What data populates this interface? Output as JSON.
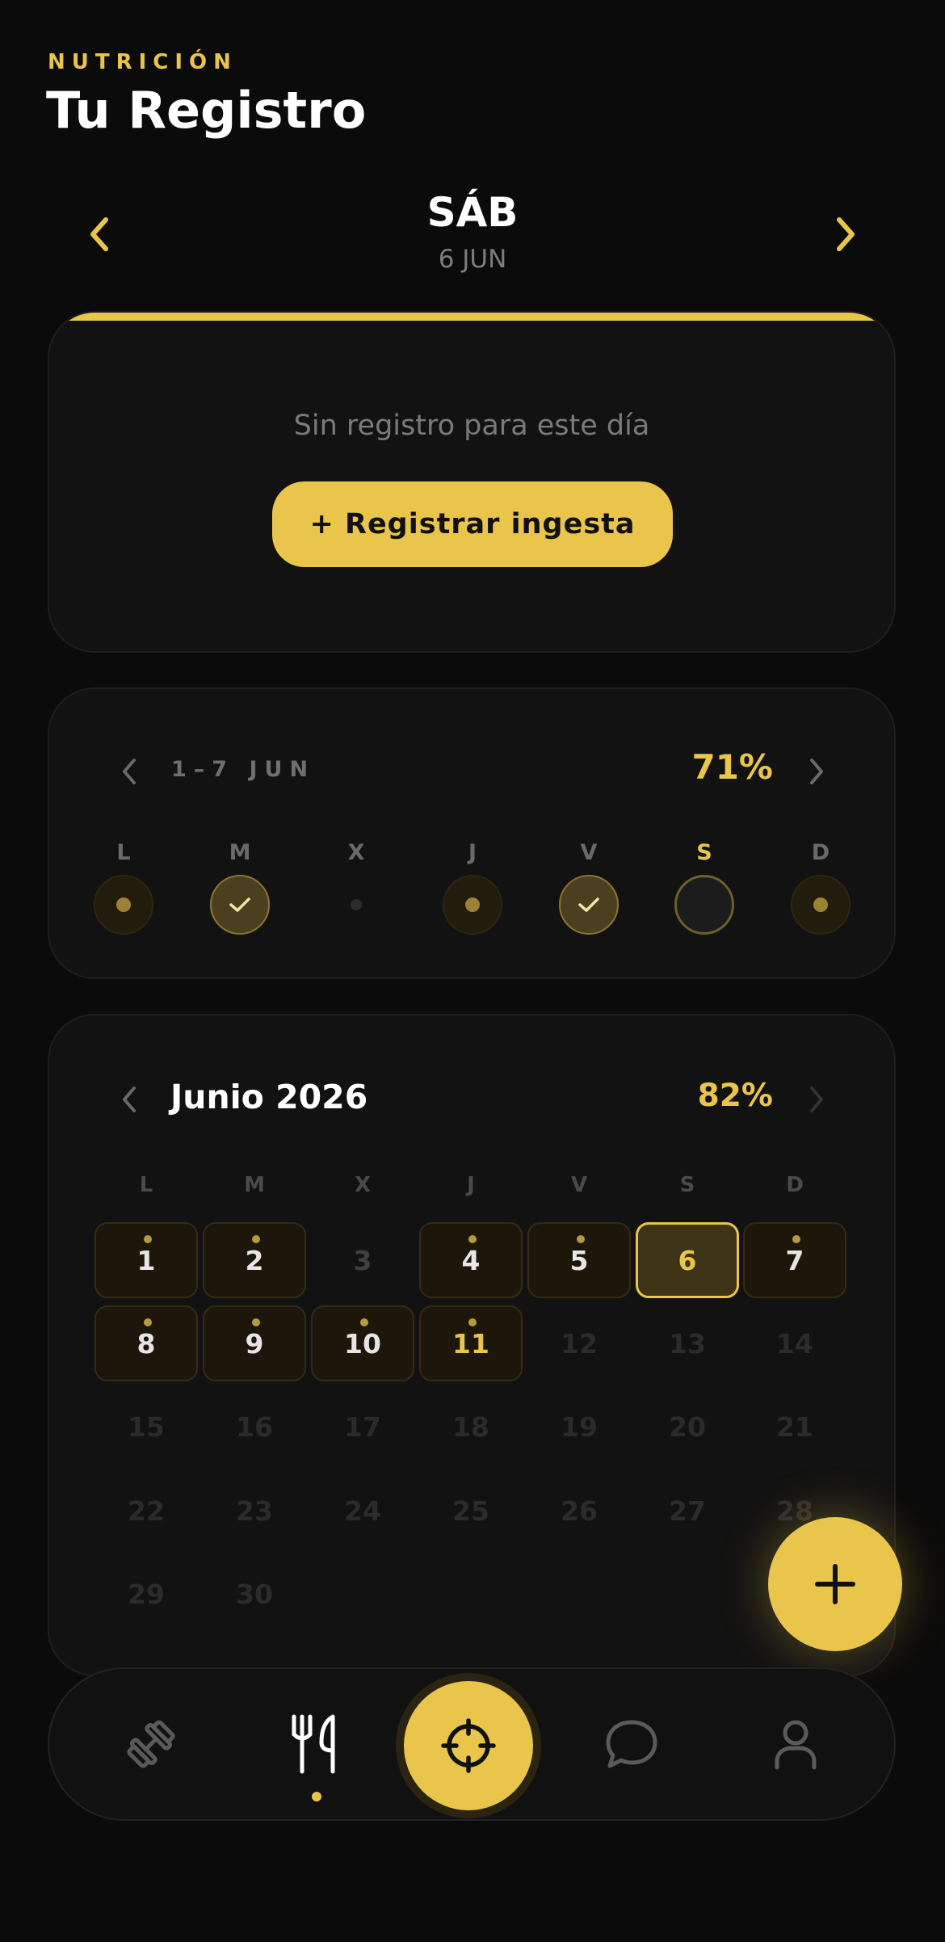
{
  "header": {
    "overline": "NUTRICIÓN",
    "title": "Tu Registro"
  },
  "day_nav": {
    "day_name": "SÁB",
    "date": "6 JUN"
  },
  "empty_day": {
    "message": "Sin registro para este día",
    "button_label": "+ Registrar ingesta"
  },
  "week": {
    "range": "1–7 JUN",
    "percent": "71%",
    "days": [
      {
        "label": "L",
        "state": "logged"
      },
      {
        "label": "M",
        "state": "complete"
      },
      {
        "label": "X",
        "state": "empty"
      },
      {
        "label": "J",
        "state": "logged"
      },
      {
        "label": "V",
        "state": "complete"
      },
      {
        "label": "S",
        "state": "today"
      },
      {
        "label": "D",
        "state": "logged"
      }
    ]
  },
  "month": {
    "title": "Junio 2026",
    "percent": "82%",
    "weekday_headers": [
      "L",
      "M",
      "X",
      "J",
      "V",
      "S",
      "D"
    ],
    "days": [
      {
        "n": "1",
        "state": "logged"
      },
      {
        "n": "2",
        "state": "logged"
      },
      {
        "n": "3",
        "state": "plain"
      },
      {
        "n": "4",
        "state": "logged"
      },
      {
        "n": "5",
        "state": "logged"
      },
      {
        "n": "6",
        "state": "today"
      },
      {
        "n": "7",
        "state": "logged"
      },
      {
        "n": "8",
        "state": "logged"
      },
      {
        "n": "9",
        "state": "logged"
      },
      {
        "n": "10",
        "state": "logged"
      },
      {
        "n": "11",
        "state": "logged-yellow"
      },
      {
        "n": "12",
        "state": "future"
      },
      {
        "n": "13",
        "state": "future"
      },
      {
        "n": "14",
        "state": "future"
      },
      {
        "n": "15",
        "state": "future"
      },
      {
        "n": "16",
        "state": "future"
      },
      {
        "n": "17",
        "state": "future"
      },
      {
        "n": "18",
        "state": "future"
      },
      {
        "n": "19",
        "state": "future"
      },
      {
        "n": "20",
        "state": "future"
      },
      {
        "n": "21",
        "state": "future"
      },
      {
        "n": "22",
        "state": "future"
      },
      {
        "n": "23",
        "state": "future"
      },
      {
        "n": "24",
        "state": "future"
      },
      {
        "n": "25",
        "state": "future"
      },
      {
        "n": "26",
        "state": "future"
      },
      {
        "n": "27",
        "state": "future"
      },
      {
        "n": "28",
        "state": "future"
      },
      {
        "n": "29",
        "state": "future"
      },
      {
        "n": "30",
        "state": "future"
      }
    ]
  },
  "tabbar": {
    "items": [
      {
        "icon": "dumbbell-icon",
        "active": false
      },
      {
        "icon": "fork-knife-icon",
        "active": true
      },
      {
        "icon": "crosshair-icon",
        "active": false
      },
      {
        "icon": "chat-bubble-icon",
        "active": false
      },
      {
        "icon": "user-icon",
        "active": false
      }
    ]
  },
  "colors": {
    "accent": "#e9c54b",
    "background": "#0b0b0b",
    "card": "#121212"
  }
}
